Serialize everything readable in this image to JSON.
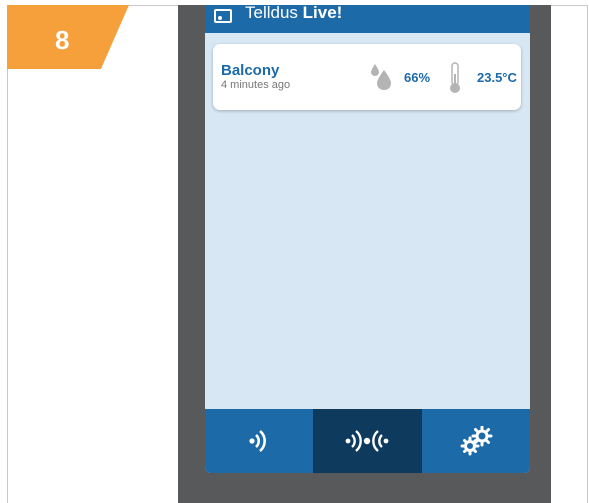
{
  "step": {
    "number": "8"
  },
  "header": {
    "title_prefix": "Telldus ",
    "title_bold": "Live!"
  },
  "sensor": {
    "name": "Balcony",
    "updated": "4 minutes ago",
    "humidity": "66%",
    "temperature": "23.5°C"
  },
  "tabs": [
    {
      "id": "devices",
      "icon": "device-signal-icon",
      "active": false
    },
    {
      "id": "sensors",
      "icon": "sensor-signal-icon",
      "active": true
    },
    {
      "id": "settings",
      "icon": "gears-icon",
      "active": false
    }
  ],
  "colors": {
    "accent": "#1c6aa8",
    "badge": "#f5a03a",
    "screen_bg": "#d7e7f4",
    "phone_bezel": "#58595b",
    "active_tab": "#0e3a5e"
  }
}
